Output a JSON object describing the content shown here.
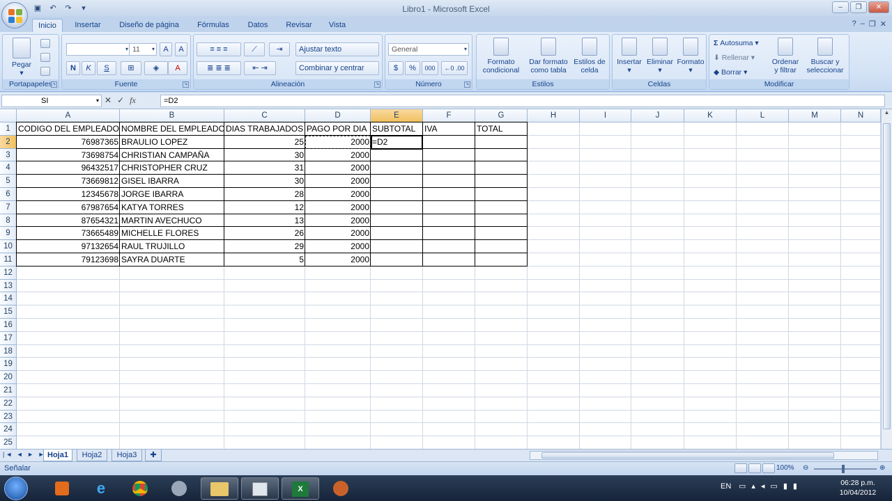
{
  "window": {
    "title": "Libro1 - Microsoft Excel"
  },
  "ribbon_tabs": [
    "Inicio",
    "Insertar",
    "Diseño de página",
    "Fórmulas",
    "Datos",
    "Revisar",
    "Vista"
  ],
  "ribbon": {
    "portapapeles": {
      "name": "Portapapeles",
      "paste": "Pegar"
    },
    "fuente": {
      "name": "Fuente",
      "font_size": "11",
      "bold": "N",
      "italic": "K",
      "underline": "S"
    },
    "alineacion": {
      "name": "Alineación",
      "wrap": "Ajustar texto",
      "merge": "Combinar y centrar"
    },
    "numero": {
      "name": "Número",
      "format": "General",
      "currency": "$",
      "percent": "%",
      "thousands": "000"
    },
    "estilos": {
      "name": "Estilos",
      "cond_format_1": "Formato",
      "cond_format_2": "condicional",
      "table_format_1": "Dar formato",
      "table_format_2": "como tabla",
      "cell_styles_1": "Estilos de",
      "cell_styles_2": "celda"
    },
    "celdas": {
      "name": "Celdas",
      "insert": "Insertar",
      "delete": "Eliminar",
      "format": "Formato"
    },
    "modificar": {
      "name": "Modificar",
      "autosum": "Autosuma",
      "fill": "Rellenar",
      "clear": "Borrar",
      "sort_1": "Ordenar",
      "sort_2": "y filtrar",
      "find_1": "Buscar y",
      "find_2": "seleccionar"
    }
  },
  "formula_bar": {
    "name_box": "SI",
    "formula": "=D2"
  },
  "columns": [
    "A",
    "B",
    "C",
    "D",
    "E",
    "F",
    "G",
    "H",
    "I",
    "J",
    "K",
    "L",
    "M",
    "N"
  ],
  "rows": [
    "1",
    "2",
    "3",
    "4",
    "5",
    "6",
    "7",
    "8",
    "9",
    "10",
    "11",
    "12",
    "13",
    "14",
    "15",
    "16",
    "17",
    "18",
    "19",
    "20",
    "21",
    "22",
    "23",
    "24",
    "25"
  ],
  "table": {
    "headers": [
      "CODIGO DEL EMPLEADO",
      "NOMBRE DEL EMPLEADO",
      "DIAS TRABAJADOS",
      "PAGO POR DIA",
      "SUBTOTAL",
      "IVA",
      "TOTAL"
    ],
    "data": [
      [
        "76987365",
        "BRAULIO LOPEZ",
        "25",
        "2000",
        "=D2"
      ],
      [
        "73698754",
        "CHRISTIAN CAMPAÑA",
        "30",
        "2000",
        ""
      ],
      [
        "96432517",
        "CHRISTOPHER CRUZ",
        "31",
        "2000",
        ""
      ],
      [
        "73669812",
        "GISEL IBARRA",
        "30",
        "2000",
        ""
      ],
      [
        "12345678",
        "JORGE IBARRA",
        "28",
        "2000",
        ""
      ],
      [
        "67987654",
        "KATYA TORRES",
        "12",
        "2000",
        ""
      ],
      [
        "87654321",
        "MARTIN AVECHUCO",
        "13",
        "2000",
        ""
      ],
      [
        "73665489",
        "MICHELLE FLORES",
        "26",
        "2000",
        ""
      ],
      [
        "97132654",
        "RAUL TRUJILLO",
        "29",
        "2000",
        ""
      ],
      [
        "79123698",
        "SAYRA DUARTE",
        "5",
        "2000",
        ""
      ]
    ]
  },
  "sheets": [
    "Hoja1",
    "Hoja2",
    "Hoja3"
  ],
  "status": {
    "mode": "Señalar",
    "zoom": "100%"
  },
  "taskbar": {
    "lang": "EN",
    "time": "06:28 p.m.",
    "date": "10/04/2012"
  },
  "colors": {
    "ribbon": "#d3e2f5",
    "selected_header": "#f1c15f",
    "taskbar": "#1c2d45"
  }
}
